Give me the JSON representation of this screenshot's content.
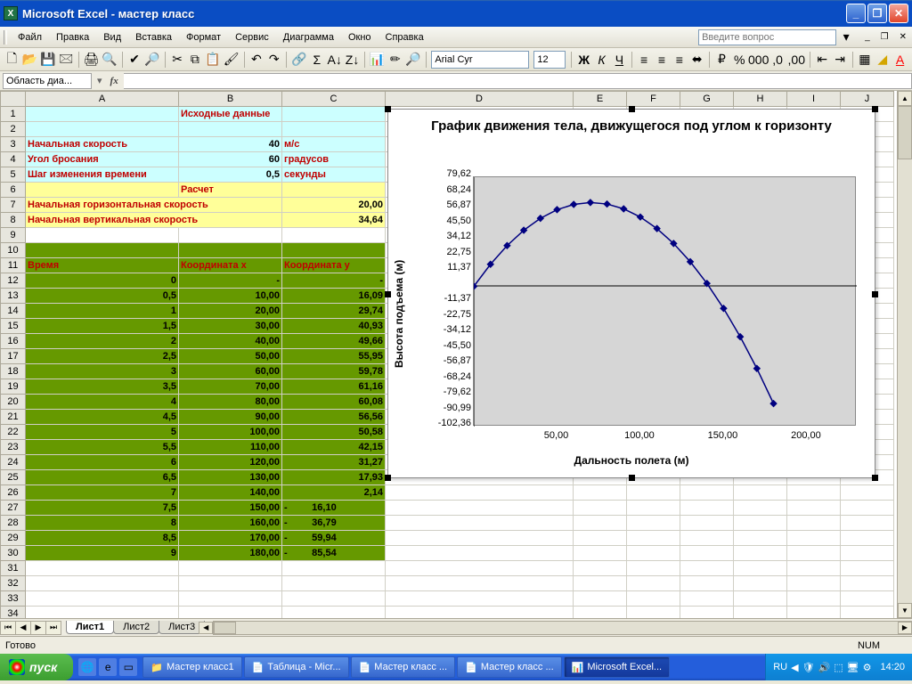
{
  "window": {
    "title": "Microsoft Excel - мастер класс"
  },
  "menu": {
    "items": [
      "Файл",
      "Правка",
      "Вид",
      "Вставка",
      "Формат",
      "Сервис",
      "Диаграмма",
      "Окно",
      "Справка"
    ],
    "help_placeholder": "Введите вопрос"
  },
  "toolbar2": {
    "font": "Arial Cyr",
    "size": "12"
  },
  "namebox": "Область диа...",
  "columns": [
    "A",
    "B",
    "C",
    "D",
    "E",
    "F",
    "G",
    "H",
    "I",
    "J"
  ],
  "sheet": {
    "r1": {
      "b": "Исходные данные"
    },
    "r3": {
      "a": "Начальная скорость",
      "b": "40",
      "c": "м/с"
    },
    "r4": {
      "a": "Угол бросания",
      "b": "60",
      "c": "градусов"
    },
    "r5": {
      "a": "Шаг изменения времени",
      "b": "0,5",
      "c": "секунды"
    },
    "r6": {
      "b": "Расчет"
    },
    "r7": {
      "a": "Начальная горизонтальная скорость",
      "c": "20,00"
    },
    "r8": {
      "a": "Начальная вертикальная скорость",
      "c": "34,64"
    },
    "r11": {
      "a": "Время",
      "b": "Координата х",
      "c": "Координата у"
    },
    "rows": [
      {
        "n": 12,
        "a": "0",
        "b": "-",
        "c": "-"
      },
      {
        "n": 13,
        "a": "0,5",
        "b": "10,00",
        "c": "16,09"
      },
      {
        "n": 14,
        "a": "1",
        "b": "20,00",
        "c": "29,74"
      },
      {
        "n": 15,
        "a": "1,5",
        "b": "30,00",
        "c": "40,93"
      },
      {
        "n": 16,
        "a": "2",
        "b": "40,00",
        "c": "49,66"
      },
      {
        "n": 17,
        "a": "2,5",
        "b": "50,00",
        "c": "55,95"
      },
      {
        "n": 18,
        "a": "3",
        "b": "60,00",
        "c": "59,78"
      },
      {
        "n": 19,
        "a": "3,5",
        "b": "70,00",
        "c": "61,16"
      },
      {
        "n": 20,
        "a": "4",
        "b": "80,00",
        "c": "60,08"
      },
      {
        "n": 21,
        "a": "4,5",
        "b": "90,00",
        "c": "56,56"
      },
      {
        "n": 22,
        "a": "5",
        "b": "100,00",
        "c": "50,58"
      },
      {
        "n": 23,
        "a": "5,5",
        "b": "110,00",
        "c": "42,15"
      },
      {
        "n": 24,
        "a": "6",
        "b": "120,00",
        "c": "31,27"
      },
      {
        "n": 25,
        "a": "6,5",
        "b": "130,00",
        "c": "17,93"
      },
      {
        "n": 26,
        "a": "7",
        "b": "140,00",
        "c": "2,14"
      },
      {
        "n": 27,
        "a": "7,5",
        "b": "150,00",
        "c": "16,10",
        "neg": true
      },
      {
        "n": 28,
        "a": "8",
        "b": "160,00",
        "c": "36,79",
        "neg": true
      },
      {
        "n": 29,
        "a": "8,5",
        "b": "170,00",
        "c": "59,94",
        "neg": true
      },
      {
        "n": 30,
        "a": "9",
        "b": "180,00",
        "c": "85,54",
        "neg": true
      }
    ],
    "blank_rows": [
      31,
      32,
      33,
      34
    ]
  },
  "chart_data": {
    "type": "line",
    "title": "График движения тела, движущегося под углом к горизонту",
    "xlabel": "Дальность полета (м)",
    "ylabel": "Высота подъема (м)",
    "x": [
      0,
      10,
      20,
      30,
      40,
      50,
      60,
      70,
      80,
      90,
      100,
      110,
      120,
      130,
      140,
      150,
      160,
      170,
      180
    ],
    "y": [
      0,
      16.09,
      29.74,
      40.93,
      49.66,
      55.95,
      59.78,
      61.16,
      60.08,
      56.56,
      50.58,
      42.15,
      31.27,
      17.93,
      2.14,
      -16.1,
      -36.79,
      -59.94,
      -85.54
    ],
    "xlim": [
      0,
      230
    ],
    "ylim": [
      -102.36,
      79.62
    ],
    "yticks": [
      "79,62",
      "68,24",
      "56,87",
      "45,50",
      "34,12",
      "22,75",
      "11,37",
      "",
      "-11,37",
      "-22,75",
      "-34,12",
      "-45,50",
      "-56,87",
      "-68,24",
      "-79,62",
      "-90,99",
      "-102,36"
    ],
    "xticks": [
      "50,00",
      "100,00",
      "150,00",
      "200,00"
    ]
  },
  "tabs": {
    "nav": [
      "⏮",
      "◀",
      "▶",
      "⏭"
    ],
    "sheets": [
      "Лист1",
      "Лист2",
      "Лист3"
    ],
    "active": 0
  },
  "status": {
    "left": "Готово",
    "num": "NUM"
  },
  "taskbar": {
    "start": "пуск",
    "buttons": [
      "Мастер класс1",
      "Таблица - Micr...",
      "Мастер класс ...",
      "Мастер класс ...",
      "Microsoft Excel..."
    ],
    "lang": "RU",
    "time": "14:20"
  }
}
